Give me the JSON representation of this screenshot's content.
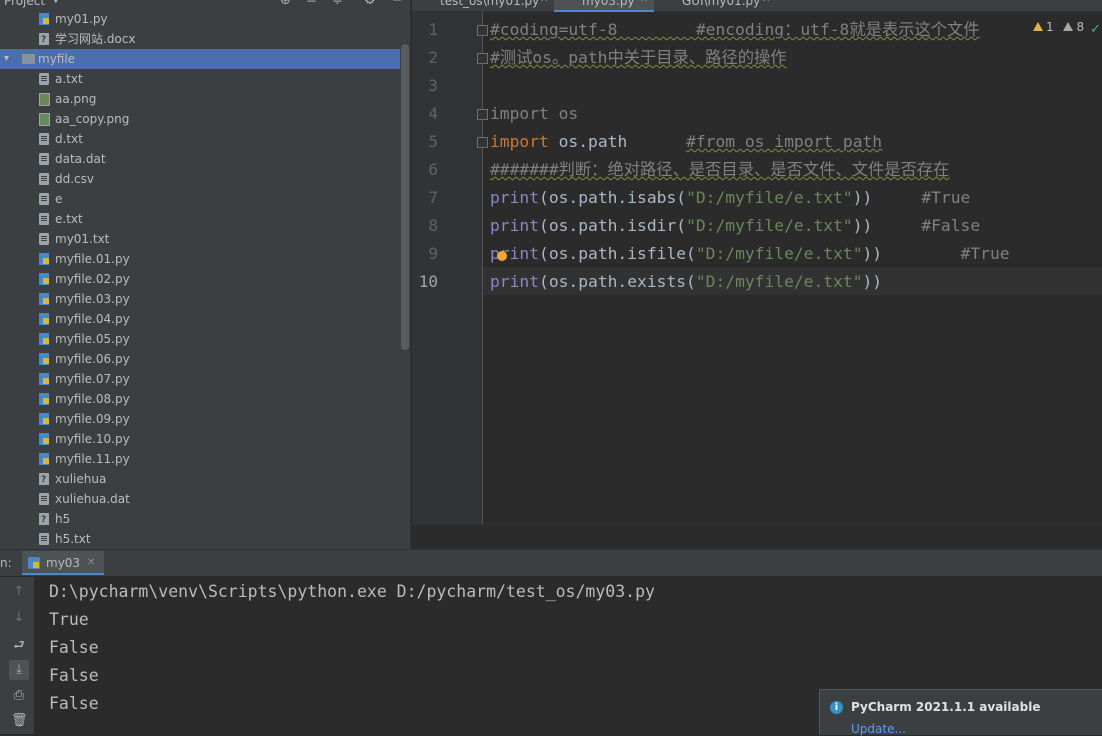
{
  "project": {
    "title": "Project",
    "header_icons": [
      "add-icon",
      "collapse-all-icon",
      "expand-icon",
      "gear-icon",
      "minimize-icon"
    ],
    "items": [
      {
        "name": "my01.py",
        "type": "py",
        "indent": 2
      },
      {
        "name": "学习网站.docx",
        "type": "unk",
        "indent": 2
      },
      {
        "name": "myfile",
        "type": "folder",
        "indent": 1,
        "selected": true,
        "expanded": true
      },
      {
        "name": "a.txt",
        "type": "txt",
        "indent": 2
      },
      {
        "name": "aa.png",
        "type": "img",
        "indent": 2
      },
      {
        "name": "aa_copy.png",
        "type": "img",
        "indent": 2
      },
      {
        "name": "d.txt",
        "type": "txt",
        "indent": 2
      },
      {
        "name": "data.dat",
        "type": "txt",
        "indent": 2
      },
      {
        "name": "dd.csv",
        "type": "txt",
        "indent": 2
      },
      {
        "name": "e",
        "type": "txt",
        "indent": 2
      },
      {
        "name": "e.txt",
        "type": "txt",
        "indent": 2
      },
      {
        "name": "my01.txt",
        "type": "txt",
        "indent": 2
      },
      {
        "name": "myfile.01.py",
        "type": "py",
        "indent": 2
      },
      {
        "name": "myfile.02.py",
        "type": "py",
        "indent": 2
      },
      {
        "name": "myfile.03.py",
        "type": "py",
        "indent": 2
      },
      {
        "name": "myfile.04.py",
        "type": "py",
        "indent": 2
      },
      {
        "name": "myfile.05.py",
        "type": "py",
        "indent": 2
      },
      {
        "name": "myfile.06.py",
        "type": "py",
        "indent": 2
      },
      {
        "name": "myfile.07.py",
        "type": "py",
        "indent": 2
      },
      {
        "name": "myfile.08.py",
        "type": "py",
        "indent": 2
      },
      {
        "name": "myfile.09.py",
        "type": "py",
        "indent": 2
      },
      {
        "name": "myfile.10.py",
        "type": "py",
        "indent": 2
      },
      {
        "name": "myfile.11.py",
        "type": "py",
        "indent": 2
      },
      {
        "name": "xuliehua",
        "type": "unk",
        "indent": 2
      },
      {
        "name": "xuliehua.dat",
        "type": "txt",
        "indent": 2
      },
      {
        "name": "h5",
        "type": "unk",
        "indent": 2
      },
      {
        "name": "h5.txt",
        "type": "txt",
        "indent": 2
      }
    ]
  },
  "editor": {
    "tabs": [
      {
        "label": "test_os\\my01.py",
        "active": false
      },
      {
        "label": "my03.py",
        "active": true
      },
      {
        "label": "GUI\\my01.py",
        "active": false
      }
    ],
    "inspections": {
      "warnings": "1",
      "weak_warnings": "8"
    },
    "current_line": "10",
    "lines": [
      {
        "num": "1",
        "tokens": [
          {
            "t": "#coding=utf-8        #encoding：utf-8就是表示这个文件",
            "c": "cm"
          }
        ]
      },
      {
        "num": "2",
        "tokens": [
          {
            "t": "#测试os。path中关于目录、路径的操作",
            "c": "cm"
          }
        ]
      },
      {
        "num": "3",
        "tokens": []
      },
      {
        "num": "4",
        "tokens": [
          {
            "t": "import os",
            "c": "cm"
          }
        ]
      },
      {
        "num": "5",
        "tokens": [
          {
            "t": "import",
            "c": "kw"
          },
          {
            "t": " os.path      ",
            "c": ""
          },
          {
            "t": "#from os import path",
            "c": "cm"
          }
        ]
      },
      {
        "num": "6",
        "tokens": [
          {
            "t": "#######判断：绝对路径、是否目录、是否文件、文件是否存在",
            "c": "cm"
          }
        ]
      },
      {
        "num": "7",
        "tokens": [
          {
            "t": "print",
            "c": "fn"
          },
          {
            "t": "(os.path.isabs(",
            "c": ""
          },
          {
            "t": "\"D:/myfile/e.txt\"",
            "c": "st"
          },
          {
            "t": "))     ",
            "c": ""
          },
          {
            "t": "#True",
            "c": "cm"
          }
        ]
      },
      {
        "num": "8",
        "tokens": [
          {
            "t": "print",
            "c": "fn"
          },
          {
            "t": "(os.path.isdir(",
            "c": ""
          },
          {
            "t": "\"D:/myfile/e.txt\"",
            "c": "st"
          },
          {
            "t": "))     ",
            "c": ""
          },
          {
            "t": "#False",
            "c": "cm"
          }
        ]
      },
      {
        "num": "9",
        "tokens": [
          {
            "t": "print",
            "c": "fn"
          },
          {
            "t": "(os.path.isfile(",
            "c": ""
          },
          {
            "t": "\"D:/myfile/e.txt\"",
            "c": "st"
          },
          {
            "t": "))        ",
            "c": ""
          },
          {
            "t": "#True",
            "c": "cm"
          }
        ]
      },
      {
        "num": "10",
        "tokens": [
          {
            "t": "print",
            "c": "fn"
          },
          {
            "t": "(os.path.exists(",
            "c": ""
          },
          {
            "t": "\"D:/myfile/e.txt\"",
            "c": "st"
          },
          {
            "t": "))",
            "c": ""
          }
        ]
      }
    ]
  },
  "run": {
    "label": "n:",
    "tab_label": "my03",
    "toolbar_icons": [
      "up-arrow-icon",
      "down-arrow-icon",
      "soft-wrap-icon",
      "scroll-to-end-icon",
      "print-icon",
      "trash-icon"
    ],
    "output": [
      "D:\\pycharm\\venv\\Scripts\\python.exe D:/pycharm/test_os/my03.py",
      "True",
      "False",
      "False",
      "False"
    ]
  },
  "notification": {
    "title": "PyCharm 2021.1.1 available",
    "link": "Update..."
  },
  "colors": {
    "accent": "#4a88c7",
    "selection": "#4b6eaf",
    "keyword": "#cc7832",
    "string": "#6a8759",
    "comment": "#808080",
    "builtin": "#8888c6"
  }
}
